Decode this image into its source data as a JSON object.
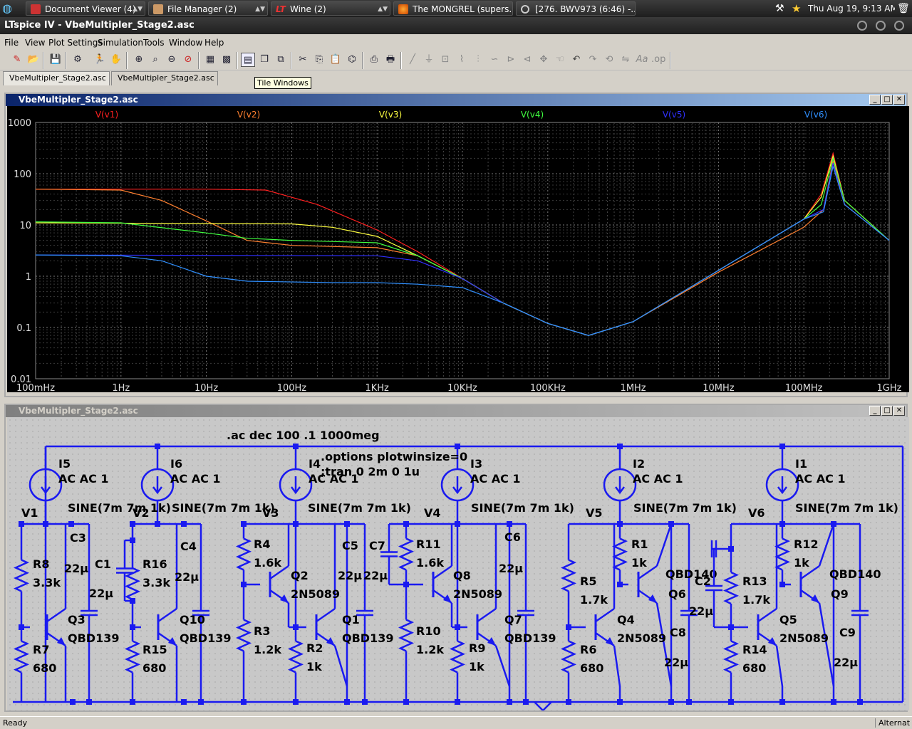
{
  "taskbar": {
    "tasks": [
      {
        "label": "Document Viewer (4)"
      },
      {
        "label": "File Manager (2)"
      },
      {
        "label": "Wine (2)"
      },
      {
        "label": "The MONGREL (supers..."
      },
      {
        "label": "[276. BWV973 (6:46) -..."
      }
    ],
    "clock": "Thu Aug 19,  9:13 AM"
  },
  "window": {
    "title": "LTspice IV - VbeMultipler_Stage2.asc"
  },
  "menu": [
    "File",
    "View",
    "Plot Settings",
    "Simulation",
    "Tools",
    "Window",
    "Help"
  ],
  "tabs": [
    "VbeMultipler_Stage2.asc",
    "VbeMultipler_Stage2.asc"
  ],
  "tooltip": "Tile Windows",
  "plot_window": {
    "title": "VbeMultipler_Stage2.asc"
  },
  "schematic_window": {
    "title": "VbeMultipler_Stage2.asc"
  },
  "status": {
    "left": "Ready",
    "right": "Alternat"
  },
  "chart_data": {
    "type": "line",
    "xscale": "log",
    "yscale": "log",
    "xlim": [
      0.1,
      1000000000
    ],
    "ylim": [
      0.01,
      1000
    ],
    "x_ticks": [
      "100mHz",
      "1Hz",
      "10Hz",
      "100Hz",
      "1KHz",
      "10KHz",
      "100KHz",
      "1MHz",
      "10MHz",
      "100MHz",
      "1GHz"
    ],
    "y_ticks": [
      "1000",
      "100",
      "10",
      "1",
      "0.1",
      "0.01"
    ],
    "grid": true,
    "legend": "top",
    "series": [
      {
        "name": "V(v1)",
        "color": "#ff2020",
        "points": [
          [
            0.1,
            50
          ],
          [
            10,
            50
          ],
          [
            50,
            48
          ],
          [
            200,
            25
          ],
          [
            1000,
            8
          ],
          [
            3000,
            3
          ],
          [
            10000,
            0.9
          ],
          [
            30000,
            0.3
          ],
          [
            100000,
            0.12
          ],
          [
            300000,
            0.07
          ],
          [
            1000000,
            0.13
          ],
          [
            10000000,
            1.3
          ],
          [
            100000000,
            13
          ],
          [
            160000000,
            40
          ],
          [
            220000000,
            250
          ],
          [
            300000000,
            30
          ],
          [
            1000000000,
            5
          ]
        ]
      },
      {
        "name": "V(v2)",
        "color": "#ff8030",
        "points": [
          [
            0.1,
            50
          ],
          [
            1,
            48
          ],
          [
            3,
            30
          ],
          [
            10,
            12
          ],
          [
            30,
            5
          ],
          [
            100,
            4
          ],
          [
            1000,
            3.6
          ],
          [
            3000,
            2.5
          ],
          [
            10000,
            0.9
          ],
          [
            30000,
            0.3
          ],
          [
            100000,
            0.12
          ],
          [
            300000,
            0.07
          ],
          [
            1000000,
            0.13
          ],
          [
            10000000,
            1.2
          ],
          [
            100000000,
            9
          ],
          [
            170000000,
            20
          ],
          [
            220000000,
            180
          ],
          [
            300000000,
            25
          ],
          [
            1000000000,
            5
          ]
        ]
      },
      {
        "name": "V(v3)",
        "color": "#ffff40",
        "points": [
          [
            0.1,
            11
          ],
          [
            100,
            10.5
          ],
          [
            300,
            9
          ],
          [
            1000,
            6
          ],
          [
            3000,
            2.5
          ],
          [
            10000,
            0.9
          ],
          [
            30000,
            0.3
          ],
          [
            100000,
            0.12
          ],
          [
            300000,
            0.07
          ],
          [
            1000000,
            0.13
          ],
          [
            10000000,
            1.3
          ],
          [
            100000000,
            13
          ],
          [
            160000000,
            35
          ],
          [
            220000000,
            220
          ],
          [
            300000000,
            30
          ],
          [
            1000000000,
            5
          ]
        ]
      },
      {
        "name": "V(v4)",
        "color": "#40ff40",
        "points": [
          [
            0.1,
            11.5
          ],
          [
            1,
            11
          ],
          [
            10,
            7
          ],
          [
            30,
            5.5
          ],
          [
            100,
            5
          ],
          [
            1000,
            4.5
          ],
          [
            3000,
            2.5
          ],
          [
            10000,
            0.9
          ],
          [
            30000,
            0.3
          ],
          [
            100000,
            0.12
          ],
          [
            300000,
            0.07
          ],
          [
            1000000,
            0.13
          ],
          [
            10000000,
            1.3
          ],
          [
            100000000,
            13
          ],
          [
            160000000,
            25
          ],
          [
            220000000,
            200
          ],
          [
            300000000,
            30
          ],
          [
            1000000000,
            5
          ]
        ]
      },
      {
        "name": "V(v5)",
        "color": "#3030ff",
        "points": [
          [
            0.1,
            2.6
          ],
          [
            1000,
            2.5
          ],
          [
            3000,
            2
          ],
          [
            10000,
            0.9
          ],
          [
            30000,
            0.3
          ],
          [
            100000,
            0.12
          ],
          [
            300000,
            0.07
          ],
          [
            1000000,
            0.13
          ],
          [
            10000000,
            1.3
          ],
          [
            100000000,
            13
          ],
          [
            170000000,
            20
          ],
          [
            220000000,
            160
          ],
          [
            300000000,
            25
          ],
          [
            1000000000,
            5
          ]
        ]
      },
      {
        "name": "V(v6)",
        "color": "#3090ff",
        "points": [
          [
            0.1,
            2.6
          ],
          [
            1,
            2.5
          ],
          [
            3,
            2
          ],
          [
            10,
            1
          ],
          [
            30,
            0.8
          ],
          [
            300,
            0.75
          ],
          [
            1000,
            0.75
          ],
          [
            3000,
            0.7
          ],
          [
            10000,
            0.6
          ],
          [
            30000,
            0.3
          ],
          [
            100000,
            0.12
          ],
          [
            300000,
            0.07
          ],
          [
            1000000,
            0.13
          ],
          [
            10000000,
            1.3
          ],
          [
            100000000,
            13
          ],
          [
            170000000,
            18
          ],
          [
            220000000,
            140
          ],
          [
            300000000,
            25
          ],
          [
            1000000000,
            5
          ]
        ]
      }
    ]
  },
  "schematic": {
    "directives": [
      ".ac dec 100 .1 1000meg",
      ".options plotwinsize=0",
      ";tran 0 2m 0 1u"
    ],
    "texts": [
      "I5",
      "AC AC 1",
      "I6",
      "AC AC 1",
      "I4",
      "AC AC 1",
      "I3",
      "AC AC 1",
      "I2",
      "AC AC 1",
      "I1",
      "AC AC 1",
      "V1",
      "SINE(7m 7m 1k)",
      "V2",
      "SINE(7m 7m 1k)",
      "V3",
      "SINE(7m 7m 1k)",
      "V4",
      "SINE(7m 7m 1k)",
      "V5",
      "SINE(7m 7m 1k)",
      "V6",
      "SINE(7m 7m 1k)",
      "C3",
      "22µ",
      "C1",
      "22µ",
      "C4",
      "22µ",
      "C5",
      "22µ",
      "C7",
      "22µ",
      "C6",
      "22µ",
      "C2",
      "22µ",
      "C8",
      "22µ",
      "C9",
      "22µ",
      "R8",
      "3.3k",
      "R16",
      "3.3k",
      "R7",
      "680",
      "R15",
      "680",
      "R4",
      "1.6k",
      "R3",
      "1.2k",
      "R2",
      "1k",
      "R11",
      "1.6k",
      "R10",
      "1.2k",
      "R9",
      "1k",
      "R5",
      "1.7k",
      "R6",
      "680",
      "R1",
      "1k",
      "R13",
      "1.7k",
      "R14",
      "680",
      "R12",
      "1k",
      "Q3",
      "QBD139",
      "Q10",
      "QBD139",
      "Q2",
      "2N5089",
      "Q1",
      "QBD139",
      "Q8",
      "2N5089",
      "Q7",
      "QBD139",
      "QBD140",
      "Q6",
      "Q4",
      "2N5089",
      "Q5",
      "2N5089",
      "QBD140",
      "Q9"
    ]
  }
}
